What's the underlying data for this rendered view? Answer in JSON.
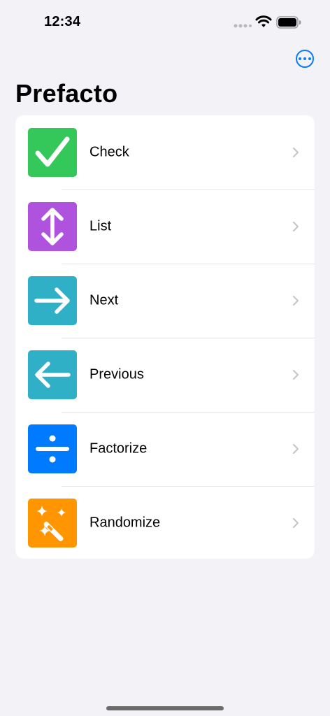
{
  "status_bar": {
    "time": "12:34",
    "icons": [
      "signal-icon",
      "wifi-icon",
      "battery-icon"
    ]
  },
  "nav": {
    "more_button_icon": "ellipsis-circle-icon",
    "title": "Prefacto"
  },
  "colors": {
    "background": "#F2F2F7",
    "card": "#FFFFFF",
    "accent": "#0A7AFF",
    "check": "#34C759",
    "list": "#AF52DE",
    "next": "#30B0C7",
    "previous": "#30B0C7",
    "factorize": "#007AFF",
    "randomize": "#FF9500",
    "chevron": "#C4C4C7"
  },
  "menu": {
    "items": [
      {
        "label": "Check",
        "icon": "checkmark-icon",
        "color": "#34C759"
      },
      {
        "label": "List",
        "icon": "arrow-up-down-icon",
        "color": "#AF52DE"
      },
      {
        "label": "Next",
        "icon": "arrow-right-icon",
        "color": "#30B0C7"
      },
      {
        "label": "Previous",
        "icon": "arrow-left-icon",
        "color": "#30B0C7"
      },
      {
        "label": "Factorize",
        "icon": "divide-icon",
        "color": "#007AFF"
      },
      {
        "label": "Randomize",
        "icon": "magic-wand-icon",
        "color": "#FF9500"
      }
    ]
  }
}
